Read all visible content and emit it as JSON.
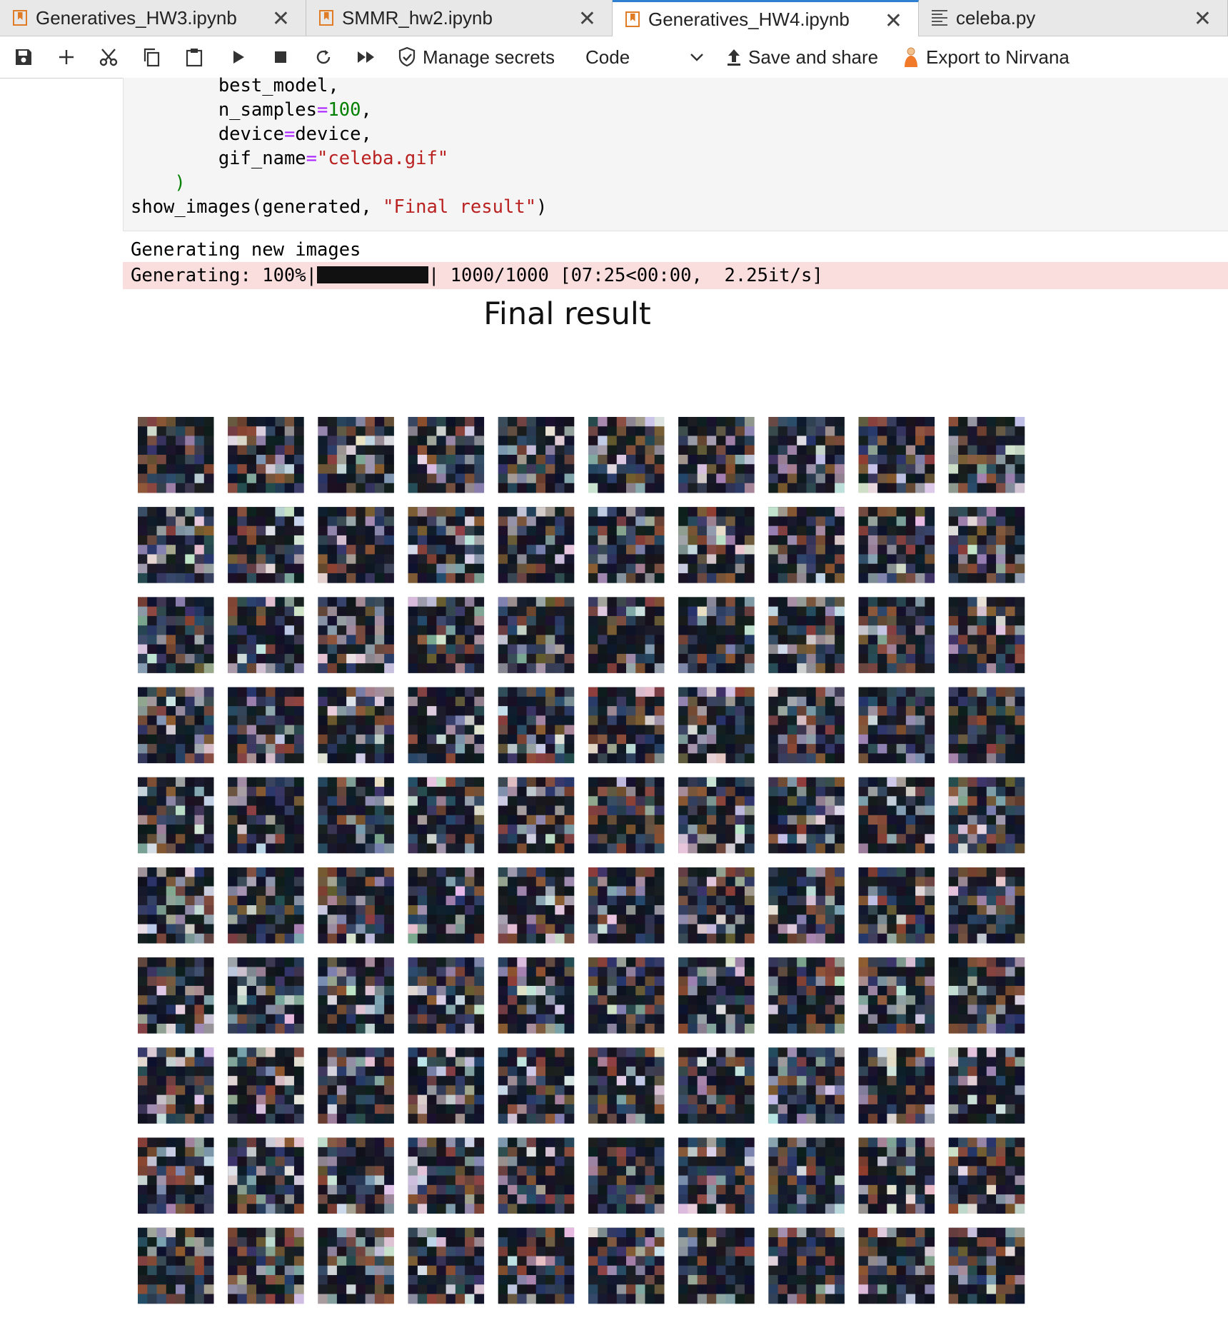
{
  "tabs": [
    {
      "label": "Generatives_HW3.ipynb",
      "icon": "notebook-icon",
      "active": false
    },
    {
      "label": "SMMR_hw2.ipynb",
      "icon": "notebook-icon",
      "active": false
    },
    {
      "label": "Generatives_HW4.ipynb",
      "icon": "notebook-icon",
      "active": true
    },
    {
      "label": "celeba.py",
      "icon": "file-text-icon",
      "active": false
    }
  ],
  "toolbar": {
    "manage_secrets": "Manage secrets",
    "cell_type": "Code",
    "save_and_share": "Save and share",
    "export": "Export to Nirvana"
  },
  "code_cell": {
    "lines": [
      {
        "indent": "        ",
        "name": "best_model",
        "op": "",
        "value": "",
        "suffix": ","
      },
      {
        "indent": "        ",
        "name": "n_samples",
        "op": "=",
        "value": "100",
        "suffix": ","
      },
      {
        "indent": "        ",
        "name": "device",
        "op": "=",
        "value": "device",
        "suffix": ","
      },
      {
        "indent": "        ",
        "name": "gif_name",
        "op": "=",
        "value": "\"celeba.gif\"",
        "suffix": ""
      }
    ],
    "close_paren": "    )",
    "last_call": "show_images(generated, ",
    "last_call_arg": "\"Final result\"",
    "last_call_end": ")"
  },
  "output": {
    "stream_text": "Generating new images",
    "progress_prefix": "Generating: 100%|",
    "progress_fraction": 1.0,
    "progress_suffix": "| 1000/1000 [07:25<00:00,  2.25it/s]"
  },
  "figure": {
    "title": "Final result",
    "rows": 10,
    "cols": 10
  },
  "colors": {
    "accent": "#2f80d1",
    "notebook_icon": "#e07b26",
    "stderr_bg": "#fadddd",
    "code_bg": "#f5f5f5"
  }
}
